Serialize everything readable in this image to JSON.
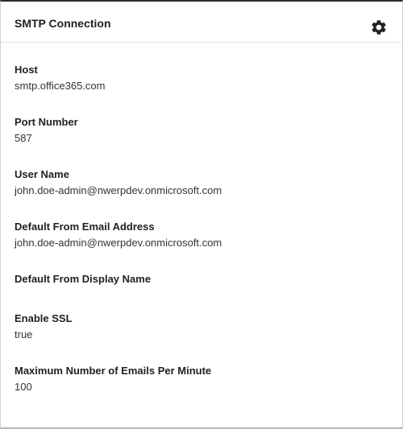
{
  "panel": {
    "title": "SMTP Connection",
    "settings_icon": "gear-icon"
  },
  "fields": [
    {
      "label": "Host",
      "value": "smtp.office365.com"
    },
    {
      "label": "Port Number",
      "value": "587"
    },
    {
      "label": "User Name",
      "value": "john.doe-admin@nwerpdev.onmicrosoft.com"
    },
    {
      "label": "Default From Email Address",
      "value": "john.doe-admin@nwerpdev.onmicrosoft.com"
    },
    {
      "label": "Default From Display Name",
      "value": ""
    },
    {
      "label": "Enable SSL",
      "value": "true"
    },
    {
      "label": "Maximum Number of Emails Per Minute",
      "value": "100"
    }
  ]
}
